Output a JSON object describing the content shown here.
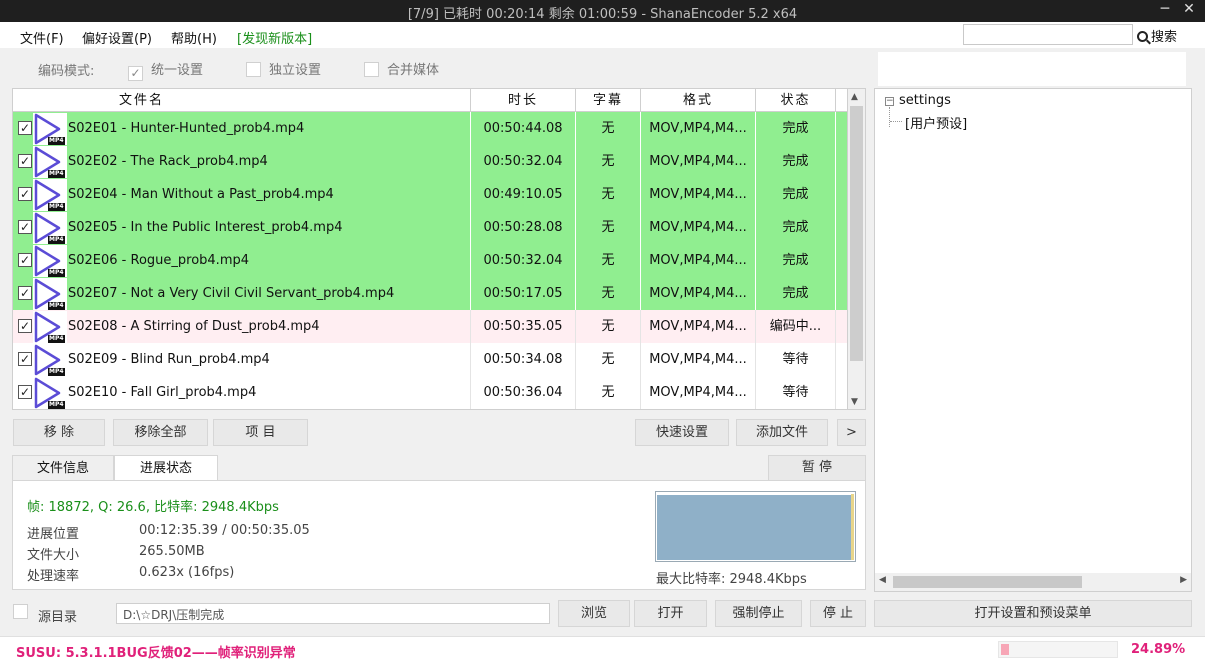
{
  "window": {
    "title": "[7/9] 已耗时 00:20:14  剩余 01:00:59 - ShanaEncoder 5.2 x64",
    "minimize": "─",
    "close": "✕"
  },
  "menu": {
    "file": "文件(F)",
    "prefs": "偏好设置(P)",
    "help": "帮助(H)",
    "new_version": "[发现新版本]"
  },
  "search": {
    "value": "",
    "placeholder": "",
    "button": "搜索"
  },
  "encode_mode": {
    "label": "编码模式:",
    "unified": "统一设置",
    "independent": "独立设置",
    "merge": "合并媒体",
    "unified_checked": true
  },
  "table": {
    "headers": [
      "文件名",
      "时长",
      "字幕",
      "格式",
      "状态"
    ],
    "rows": [
      {
        "name": "S02E01 - Hunter-Hunted_prob4.mp4",
        "duration": "00:50:44.08",
        "subtitle": "无",
        "format": "MOV,MP4,M4...",
        "status": "完成",
        "state": "done"
      },
      {
        "name": "S02E02 - The Rack_prob4.mp4",
        "duration": "00:50:32.04",
        "subtitle": "无",
        "format": "MOV,MP4,M4...",
        "status": "完成",
        "state": "done"
      },
      {
        "name": "S02E04 - Man Without a Past_prob4.mp4",
        "duration": "00:49:10.05",
        "subtitle": "无",
        "format": "MOV,MP4,M4...",
        "status": "完成",
        "state": "done"
      },
      {
        "name": "S02E05 - In the Public Interest_prob4.mp4",
        "duration": "00:50:28.08",
        "subtitle": "无",
        "format": "MOV,MP4,M4...",
        "status": "完成",
        "state": "done"
      },
      {
        "name": "S02E06 - Rogue_prob4.mp4",
        "duration": "00:50:32.04",
        "subtitle": "无",
        "format": "MOV,MP4,M4...",
        "status": "完成",
        "state": "done"
      },
      {
        "name": "S02E07 - Not a Very Civil Civil Servant_prob4.mp4",
        "duration": "00:50:17.05",
        "subtitle": "无",
        "format": "MOV,MP4,M4...",
        "status": "完成",
        "state": "done"
      },
      {
        "name": "S02E08 - A Stirring of Dust_prob4.mp4",
        "duration": "00:50:35.05",
        "subtitle": "无",
        "format": "MOV,MP4,M4...",
        "status": "编码中...",
        "state": "enc"
      },
      {
        "name": "S02E09 - Blind Run_prob4.mp4",
        "duration": "00:50:34.08",
        "subtitle": "无",
        "format": "MOV,MP4,M4...",
        "status": "等待",
        "state": "wait"
      },
      {
        "name": "S02E10 - Fall Girl_prob4.mp4",
        "duration": "00:50:36.04",
        "subtitle": "无",
        "format": "MOV,MP4,M4...",
        "status": "等待",
        "state": "wait"
      }
    ],
    "icon_badge": "MP4"
  },
  "actions": {
    "remove": "移 除",
    "remove_all": "移除全部",
    "item": "项 目",
    "quick_settings": "快速设置",
    "add_file": "添加文件",
    "more": ">"
  },
  "tabs": {
    "file_info": "文件信息",
    "progress": "进展状态",
    "pause": "暂 停"
  },
  "progress": {
    "stat_line": "帧: 18872, Q: 26.6, 比特率: 2948.4Kbps",
    "position_label": "进展位置",
    "position_value": "00:12:35.39 / 00:50:35.05",
    "size_label": "文件大小",
    "size_value": "265.50MB",
    "speed_label": "处理速率",
    "speed_value": "0.623x (16fps)",
    "max_bitrate": "最大比特率: 2948.4Kbps"
  },
  "settings_tree": {
    "root": "settings",
    "child": "[用户预设]"
  },
  "bottom": {
    "source_dir_label": "源目录",
    "path_value": "D:\\☆DRJ\\压制完成",
    "browse": "浏览",
    "open": "打开",
    "force_stop": "强制停止",
    "stop": "停 止",
    "open_settings": "打开设置和预设菜单"
  },
  "status": {
    "message": "SUSU: 5.3.1.1BUG反馈02——帧率识别异常",
    "percent_text": "24.89%",
    "percent": 24.89
  },
  "colors": {
    "done": "#90ee90",
    "encoding": "#ffeef2",
    "accent": "#e0217a",
    "icon": "#5b4cd6"
  }
}
